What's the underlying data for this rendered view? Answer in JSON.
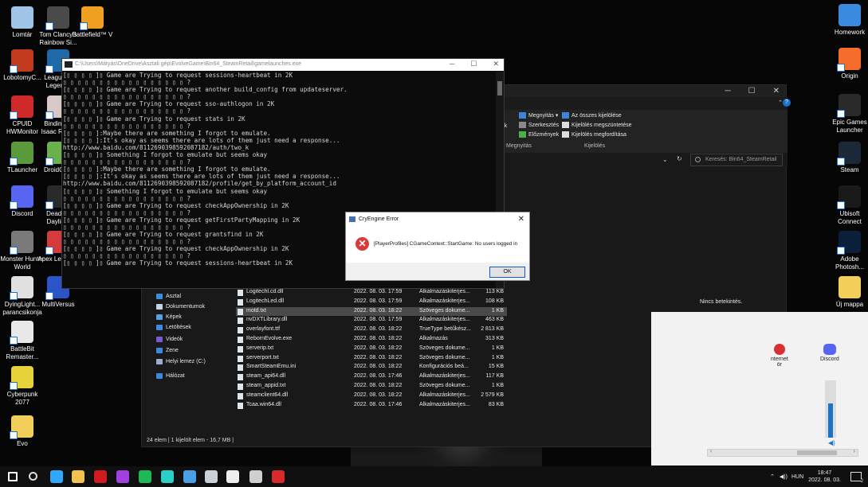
{
  "desktop": {
    "left_icons": [
      {
        "label": "Lomtár",
        "icon": "recycle-bin-icon",
        "color": "#9fc4e8"
      },
      {
        "label": "Tom Clancy's Rainbow Si...",
        "icon": "rainbow-six-icon",
        "color": "#4a4a4a"
      },
      {
        "label": "Battlefield™ V",
        "icon": "battlefield-icon",
        "color": "#f0a020"
      },
      {
        "label": "LobotomyC...",
        "icon": "lobotomy-icon",
        "color": "#c23a1e"
      },
      {
        "label": "League of Legends",
        "icon": "league-icon",
        "color": "#1f6aa6"
      },
      {
        "label": "CPUID HWMonitor",
        "icon": "hwmonitor-icon",
        "color": "#cf2a2a"
      },
      {
        "label": "Binding of Isaac Reb...",
        "icon": "isaac-icon",
        "color": "#d8c8c8"
      },
      {
        "label": "TLauncher",
        "icon": "tlauncher-icon",
        "color": "#5a9a3a"
      },
      {
        "label": "DroidCam",
        "icon": "droidcam-icon",
        "color": "#6ab04c"
      },
      {
        "label": "Discord",
        "icon": "discord-icon",
        "color": "#5865f2"
      },
      {
        "label": "Dead by Daylight",
        "icon": "dbd-icon",
        "color": "#2a2a2a"
      },
      {
        "label": "Monster Hunter World",
        "icon": "monster-hunter-icon",
        "color": "#7a7a7a"
      },
      {
        "label": "Apex Legends",
        "icon": "apex-icon",
        "color": "#d63a3a"
      },
      {
        "label": "DyingLight... parancsikonja",
        "icon": "dying-light-icon",
        "color": "#e0e0e0"
      },
      {
        "label": "MultiVersus",
        "icon": "multiversus-icon",
        "color": "#2a54c8"
      },
      {
        "label": "BattleBit Remaster...",
        "icon": "battlebit-icon",
        "color": "#e8e8e8"
      },
      {
        "label": "Cyberpunk 2077",
        "icon": "cyberpunk-icon",
        "color": "#e8d23a"
      },
      {
        "label": "Evo",
        "icon": "folder-icon",
        "color": "#f2cf5b"
      }
    ],
    "right_icons": [
      {
        "label": "Homework",
        "icon": "folder-icon",
        "color": "#3a8ae0"
      },
      {
        "label": "Origin",
        "icon": "origin-icon",
        "color": "#f56c2d"
      },
      {
        "label": "Epic Games Launcher",
        "icon": "epic-games-icon",
        "color": "#2a2a2a"
      },
      {
        "label": "Steam",
        "icon": "steam-icon",
        "color": "#1b2838"
      },
      {
        "label": "Ubisoft Connect",
        "icon": "ubisoft-icon",
        "color": "#1a1a1a"
      },
      {
        "label": "Adobe Photosh...",
        "icon": "photoshop-icon",
        "color": "#0c1f3a"
      },
      {
        "label": "Új mappa",
        "icon": "folder-icon",
        "color": "#f2cf5b"
      }
    ]
  },
  "console": {
    "title": "C:\\Users\\Mátyás\\OneDrive\\Asztali gép\\EvolveGame\\Bin64_SteamRetail\\gamelaunches.exe",
    "lines": [
      "[▯ ▯ ▯ ▯ ]▯ Game are Trying to request sessions-heartbeat in 2K",
      "▯ ▯ ▯ ▯ ▯ ▯ ▯ ▯ ▯ ▯ ▯ ▯ ▯ ▯ ▯ ▯ ▯ ?",
      "[▯ ▯ ▯ ▯ ]▯ Game are Trying to request another build_config from updateserver.",
      "▯ ▯ ▯ ▯ ▯ ▯ ▯ ▯ ▯ ▯ ▯ ▯ ▯ ▯ ▯ ▯ ▯ ?",
      "[▯ ▯ ▯ ▯ ]▯ Game are Trying to request sso-authlogon in 2K",
      "▯ ▯ ▯ ▯ ▯ ▯ ▯ ▯ ▯ ▯ ▯ ▯ ▯ ▯ ▯ ▯ ▯ ?",
      "[▯ ▯ ▯ ▯ ]▯ Game are Trying to request stats in 2K",
      "▯ ▯ ▯ ▯ ▯ ▯ ▯ ▯ ▯ ▯ ▯ ▯ ▯ ▯ ▯ ▯ ▯ ?",
      "[▯ ▯ ▯ ▯ ]:Maybe there are something I forgot to emulate.",
      "[▯ ▯ ▯ ▯ ]:It's okay as seems there are lots of them just need a response...",
      "http://www.baidu.com/8112690398592087182/auth/two_k",
      "[▯ ▯ ▯ ▯ ]▯ Something I forgot to emulate but seems okay",
      "▯ ▯ ▯ ▯ ▯ ▯ ▯ ▯ ▯ ▯ ▯ ▯ ▯ ▯ ▯ ▯ ▯ ?",
      "[▯ ▯ ▯ ▯ ]:Maybe there are something I forgot to emulate.",
      "[▯ ▯ ▯ ▯ ]:It's okay as seems there are lots of them just need a response...",
      "http://www.baidu.com/8112690398592087182/profile/get_by_platform_account_id",
      "[▯ ▯ ▯ ▯ ]▯ Something I forgot to emulate but seems okay",
      "▯ ▯ ▯ ▯ ▯ ▯ ▯ ▯ ▯ ▯ ▯ ▯ ▯ ▯ ▯ ▯ ▯ ?",
      "[▯ ▯ ▯ ▯ ]▯ Game are Trying to request checkAppOwnership in 2K",
      "▯ ▯ ▯ ▯ ▯ ▯ ▯ ▯ ▯ ▯ ▯ ▯ ▯ ▯ ▯ ▯ ▯ ?",
      "[▯ ▯ ▯ ▯ ]▯ Game are Trying to request getFirstPartyMapping in 2K",
      "▯ ▯ ▯ ▯ ▯ ▯ ▯ ▯ ▯ ▯ ▯ ▯ ▯ ▯ ▯ ▯ ▯ ?",
      "[▯ ▯ ▯ ▯ ]▯ Game are Trying to request grantsfind in 2K",
      "▯ ▯ ▯ ▯ ▯ ▯ ▯ ▯ ▯ ▯ ▯ ▯ ▯ ▯ ▯ ▯ ▯ ?",
      "[▯ ▯ ▯ ▯ ]▯ Game are Trying to request checkAppOwnership in 2K",
      "▯ ▯ ▯ ▯ ▯ ▯ ▯ ▯ ▯ ▯ ▯ ▯ ▯ ▯ ▯ ▯ ▯ ?",
      "[▯ ▯ ▯ ▯ ]▯ Game are Trying to request sessions-heartbeat in 2K"
    ]
  },
  "dialog": {
    "title": "CryEngine Error",
    "message": "[PlayerProfiles] CGameContext::StartGame: No users logged in",
    "ok_label": "OK",
    "close_glyph": "✕"
  },
  "explorer": {
    "ribbon": {
      "open_label": "Megnyitás ▾",
      "edit_label": "Szerkesztés",
      "history_label": "Előzmények",
      "select_all_label": "Az összes kijelölése",
      "select_none_label": "Kijelölés megszüntetése",
      "invert_label": "Kijelölés megfordítása",
      "group_open": "Megnyitás",
      "group_select": "Kijelölés",
      "partial_label": "gok"
    },
    "search_placeholder": "Keresés: Bin64_SteamRetail",
    "nav": [
      {
        "label": "Asztal",
        "icon": "desktop-folder-icon",
        "color": "#3a8ae0"
      },
      {
        "label": "Dokumentumok",
        "icon": "documents-icon",
        "color": "#c8d4e4"
      },
      {
        "label": "Képek",
        "icon": "pictures-icon",
        "color": "#5aa0e0"
      },
      {
        "label": "Letöltések",
        "icon": "downloads-icon",
        "color": "#3a8ae0"
      },
      {
        "label": "Videók",
        "icon": "videos-icon",
        "color": "#7a5ad0"
      },
      {
        "label": "Zene",
        "icon": "music-icon",
        "color": "#3a8ae0"
      },
      {
        "label": "Helyi lemez (C:)",
        "icon": "drive-icon",
        "color": "#9ab0c8"
      },
      {
        "label": "Hálózat",
        "icon": "network-icon",
        "color": "#3a8ae0"
      }
    ],
    "files": [
      {
        "name": "Logitechl.cd.dll",
        "date": "2022. 08. 03. 17:59",
        "type": "Alkalmazáskiterjes...",
        "size": "113 KB",
        "selected": false
      },
      {
        "name": "LogitechLed.dll",
        "date": "2022. 08. 03. 17:59",
        "type": "Alkalmazáskiterjes...",
        "size": "108 KB",
        "selected": false
      },
      {
        "name": "motd.txt",
        "date": "2022. 08. 03. 18:22",
        "type": "Szöveges dokume...",
        "size": "1 KB",
        "selected": true
      },
      {
        "name": "nvDXTLibrary.dll",
        "date": "2022. 08. 03. 17:59",
        "type": "Alkalmazáskiterjes...",
        "size": "463 KB",
        "selected": false
      },
      {
        "name": "overlayfont.ttf",
        "date": "2022. 08. 03. 18:22",
        "type": "TrueType betűkész...",
        "size": "2 813 KB",
        "selected": false
      },
      {
        "name": "RebornEvolve.exe",
        "date": "2022. 08. 03. 18:22",
        "type": "Alkalmazás",
        "size": "313 KB",
        "selected": false
      },
      {
        "name": "serverip.txt",
        "date": "2022. 08. 03. 18:22",
        "type": "Szöveges dokume...",
        "size": "1 KB",
        "selected": false
      },
      {
        "name": "serverport.txt",
        "date": "2022. 08. 03. 18:22",
        "type": "Szöveges dokume...",
        "size": "1 KB",
        "selected": false
      },
      {
        "name": "SmartSteamEmu.ini",
        "date": "2022. 08. 03. 18:22",
        "type": "Konfigurációs beá...",
        "size": "15 KB",
        "selected": false
      },
      {
        "name": "steam_api64.dll",
        "date": "2022. 08. 03. 17:46",
        "type": "Alkalmazáskiterjes...",
        "size": "117 KB",
        "selected": false
      },
      {
        "name": "steam_appid.txt",
        "date": "2022. 08. 03. 18:22",
        "type": "Szöveges dokume...",
        "size": "1 KB",
        "selected": false
      },
      {
        "name": "steamclient64.dll",
        "date": "2022. 08. 03. 18:22",
        "type": "Alkalmazáskiterjes...",
        "size": "2 579 KB",
        "selected": false
      },
      {
        "name": "Tcaa.win64.dll",
        "date": "2022. 08. 03. 17:46",
        "type": "Alkalmazáskiterjes...",
        "size": "83 KB",
        "selected": false
      }
    ],
    "no_preview": "Nincs betekintés.",
    "status": "24 elem  |  1 kijelölt elem - 16,7 MB  |"
  },
  "flyout": {
    "apps": [
      {
        "label": "nternet",
        "sub": "ör"
      },
      {
        "label": "Discord",
        "sub": ""
      }
    ],
    "volume_level": 0.6,
    "left_arrow": "‹",
    "right_arrow": "›"
  },
  "taskbar": {
    "icons": [
      {
        "name": "start-icon",
        "color": "#ffffff"
      },
      {
        "name": "search-icon",
        "color": "#dddddd"
      },
      {
        "name": "photoshop-icon",
        "color": "#31a8ff"
      },
      {
        "name": "file-explorer-icon",
        "color": "#f2c14e"
      },
      {
        "name": "opera-icon",
        "color": "#d01c1f"
      },
      {
        "name": "messenger-icon",
        "color": "#a040e0"
      },
      {
        "name": "spotify-icon",
        "color": "#1db954"
      },
      {
        "name": "surfshark-icon",
        "color": "#2ad0c8"
      },
      {
        "name": "notepad-icon",
        "color": "#4aa0e8"
      },
      {
        "name": "steam-icon",
        "color": "#c8d0d8"
      },
      {
        "name": "settings-icon",
        "color": "#eeeeee"
      },
      {
        "name": "gamelaunches-icon",
        "color": "#cfcfcf"
      },
      {
        "name": "cryengine-icon",
        "color": "#d82a2a"
      }
    ],
    "language": "HUN",
    "time": "18:47",
    "date": "2022. 08. 03.",
    "notification_count": "2"
  }
}
